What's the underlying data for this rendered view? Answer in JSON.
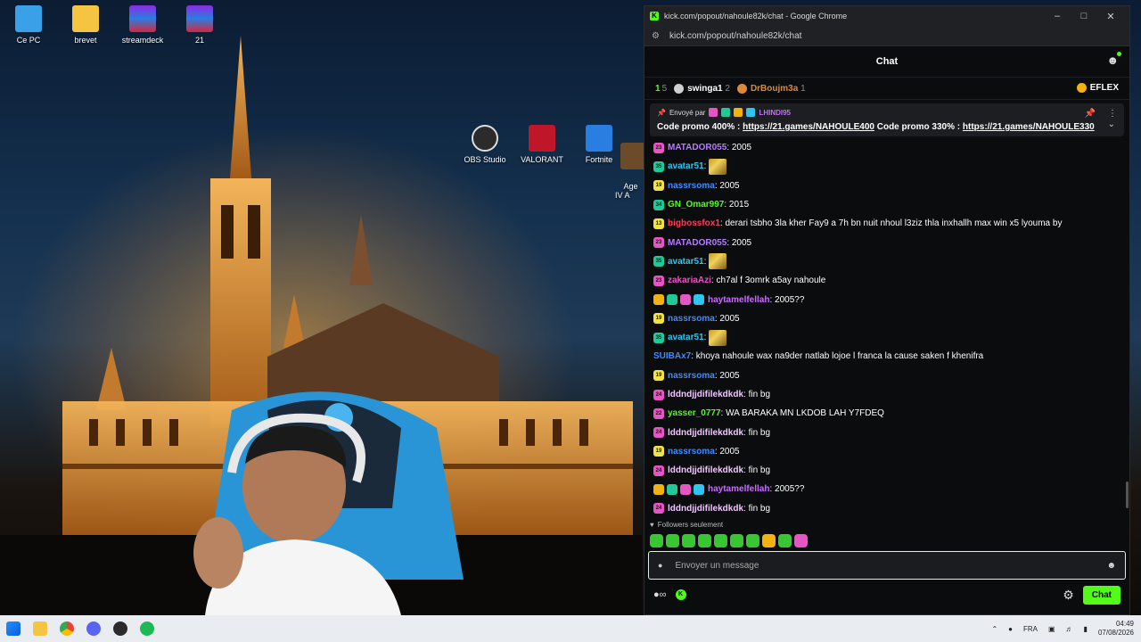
{
  "desktop": {
    "icons": [
      {
        "label": "Ce PC",
        "color": "#3aa0e8"
      },
      {
        "label": "brevet",
        "color": "#f5c542"
      },
      {
        "label": "streamdeck",
        "color": "#8a2be2"
      },
      {
        "label": "21",
        "color": "#8a2be2"
      },
      {
        "label": "OBS Studio",
        "color": "#2b2b2b"
      },
      {
        "label": "VALORANT",
        "color": "#c0162a"
      },
      {
        "label": "Fortnite",
        "color": "#2a7de1"
      },
      {
        "label": "Age\nIV A",
        "color": "#6b4b2a"
      }
    ]
  },
  "window": {
    "title": "kick.com/popout/nahoule82k/chat - Google Chrome",
    "url": "kick.com/popout/nahoule82k/chat"
  },
  "chat": {
    "header_title": "Chat",
    "leaderboard": [
      {
        "rank": "1",
        "name": "",
        "gifts": "5",
        "badge_color": ""
      },
      {
        "rank": "",
        "name": "swinga1",
        "gifts": "2",
        "badge_color": "#cfcfcf"
      },
      {
        "rank": "",
        "name": "DrBoujm3a",
        "gifts": "1",
        "badge_color": "#d98b3a"
      }
    ],
    "leaderboard_right": "EFLEX",
    "pinned": {
      "sent_by": "Envoyé par",
      "user": "LHINDI95",
      "text_1": "Code promo 400% : ",
      "link_1": "https://21.games/NAHOULE400",
      "text_2": " Code promo 330% : ",
      "link_2": "https://21.games/NAHOULE330"
    },
    "messages": [
      {
        "badge": "23",
        "badge_color": "#e754c4",
        "user": "MATADOR055",
        "user_color": "#b57bff",
        "text": ": 2005",
        "emote": false
      },
      {
        "badge": "35",
        "badge_color": "#20c997",
        "user": "avatar51",
        "user_color": "#2ec6f0",
        "text": ":",
        "emote": true
      },
      {
        "badge": "19",
        "badge_color": "#f2e24a",
        "user": "nassrsoma",
        "user_color": "#3c8cff",
        "text": ": 2005",
        "emote": false
      },
      {
        "badge": "34",
        "badge_color": "#20c997",
        "user": "GN_Omar997",
        "user_color": "#53fc18",
        "text": ": 2015",
        "emote": false
      },
      {
        "badge": "13",
        "badge_color": "#f2e24a",
        "user": "bigbossfox1",
        "user_color": "#ff3b5c",
        "text": ": derari tsbho 3la kher Fay9 a 7h bn nuit nhoul l3ziz thla inxhallh max win x5 lyouma by",
        "emote": false
      },
      {
        "badge": "23",
        "badge_color": "#e754c4",
        "user": "MATADOR055",
        "user_color": "#b57bff",
        "text": ": 2005",
        "emote": false
      },
      {
        "badge": "35",
        "badge_color": "#20c997",
        "user": "avatar51",
        "user_color": "#2ec6f0",
        "text": ":",
        "emote": true
      },
      {
        "badge": "23",
        "badge_color": "#e754c4",
        "user": "zakariaAzi",
        "user_color": "#e754c4",
        "text": ": ch7al f 3omrk a5ay nahoule",
        "emote": false
      },
      {
        "badge": "",
        "badge_color": "",
        "user": "haytamelfellah",
        "user_color": "#c76cff",
        "text": ": 2005??",
        "emote": false,
        "multi": true
      },
      {
        "badge": "19",
        "badge_color": "#f2e24a",
        "user": "nassrsoma",
        "user_color": "#3c8cff",
        "text": ": 2005",
        "emote": false
      },
      {
        "badge": "35",
        "badge_color": "#20c997",
        "user": "avatar51",
        "user_color": "#2ec6f0",
        "text": ":",
        "emote": true
      },
      {
        "badge": "",
        "badge_color": "",
        "user": "SUIBAx7",
        "user_color": "#3c8cff",
        "text": ": khoya nahoule wax na9der natlab lojoe l franca la cause saken f khenifra",
        "emote": false
      },
      {
        "badge": "19",
        "badge_color": "#f2e24a",
        "user": "nassrsoma",
        "user_color": "#3c8cff",
        "text": ": 2005",
        "emote": false
      },
      {
        "badge": "24",
        "badge_color": "#e754c4",
        "user": "lddndjjdifilekdkdk",
        "user_color": "#f0c6ff",
        "text": ": fin bg",
        "emote": false
      },
      {
        "badge": "22",
        "badge_color": "#e754c4",
        "user": "yasser_0777",
        "user_color": "#53fc18",
        "text": ": WA BARAKA MN LKDOB LAH Y7FDEQ",
        "emote": false
      },
      {
        "badge": "24",
        "badge_color": "#e754c4",
        "user": "lddndjjdifilekdkdk",
        "user_color": "#f0c6ff",
        "text": ": fin bg",
        "emote": false
      },
      {
        "badge": "19",
        "badge_color": "#f2e24a",
        "user": "nassrsoma",
        "user_color": "#3c8cff",
        "text": ": 2005",
        "emote": false
      },
      {
        "badge": "24",
        "badge_color": "#e754c4",
        "user": "lddndjjdifilekdkdk",
        "user_color": "#f0c6ff",
        "text": ": fin bg",
        "emote": false
      },
      {
        "badge": "",
        "badge_color": "",
        "user": "haytamelfellah",
        "user_color": "#c76cff",
        "text": ": 2005??",
        "emote": false,
        "multi": true
      },
      {
        "badge": "24",
        "badge_color": "#e754c4",
        "user": "lddndjjdifilekdkdk",
        "user_color": "#f0c6ff",
        "text": ": fin bg",
        "emote": false
      }
    ],
    "followers_only": "Followers seulement",
    "input_placeholder": "Envoyer un message",
    "send_label": "Chat"
  },
  "taskbar": {
    "apps": [
      "windows-start",
      "file-explorer",
      "chrome",
      "discord",
      "obs",
      "spotify"
    ],
    "lang": "FRA",
    "time": "04:49",
    "date": "07/08/2026"
  },
  "colors": {
    "kick_green": "#53fc18",
    "panel_bg": "#0b0c0d"
  }
}
